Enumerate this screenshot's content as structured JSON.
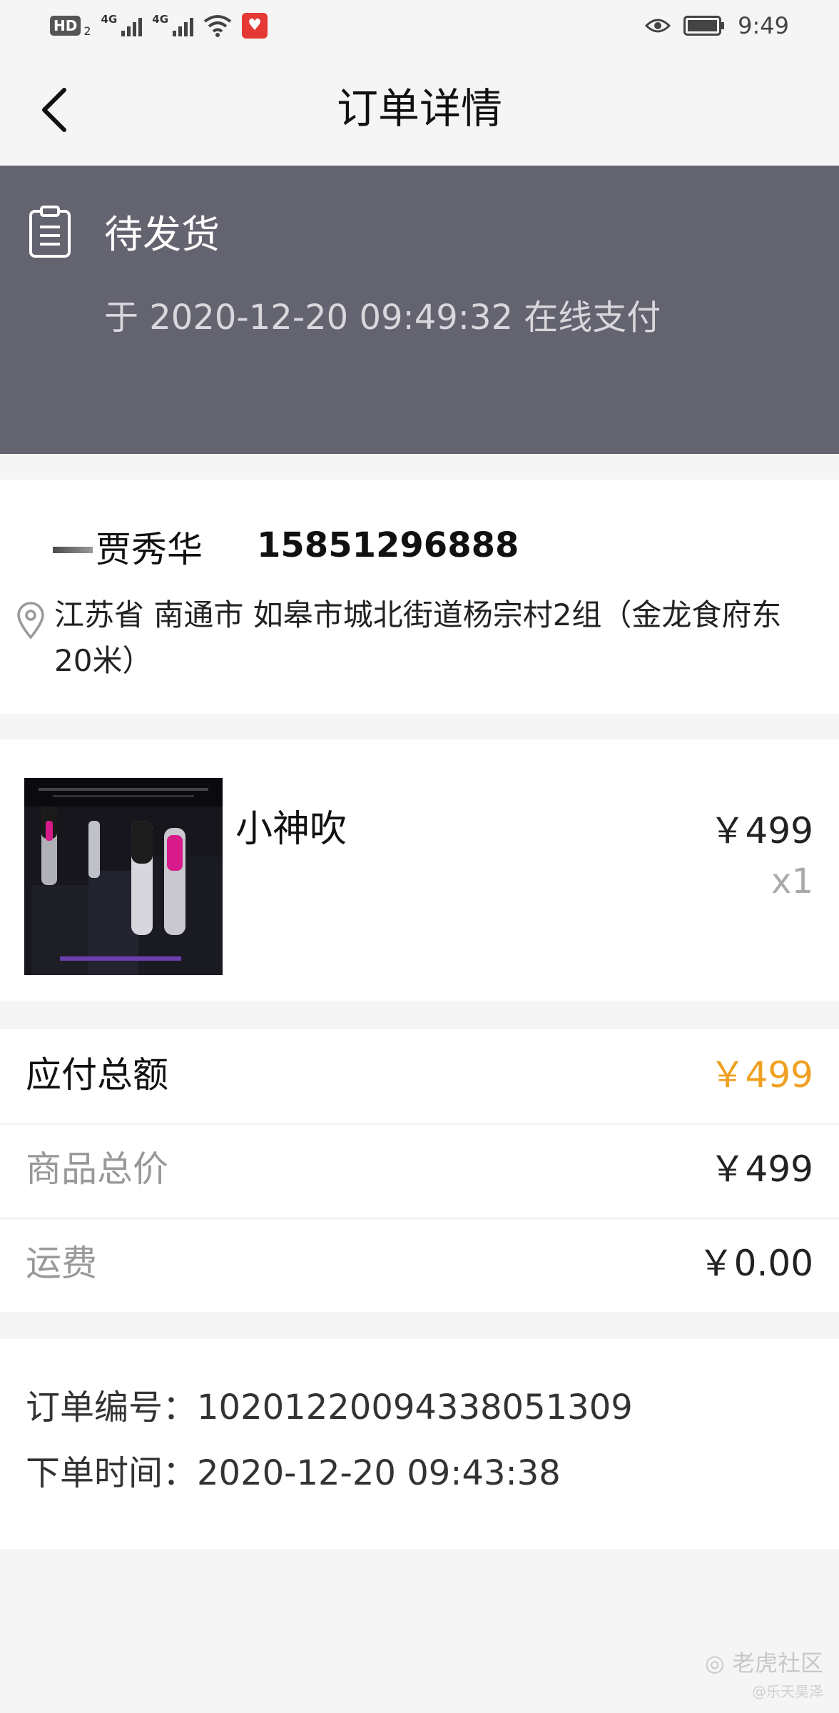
{
  "status_bar": {
    "hd": "HD",
    "hd_sub": "2",
    "network_1": "4G",
    "network_2": "4G",
    "time": "9:49"
  },
  "header": {
    "title": "订单详情"
  },
  "order_status": {
    "title": "待发货",
    "subtitle": "于 2020-12-20 09:49:32 在线支付"
  },
  "recipient": {
    "name": "贾秀华",
    "phone": "15851296888",
    "address": "江苏省 南通市 如皋市城北街道杨宗村2组（金龙食府东20米）"
  },
  "product": {
    "name": "小神吹",
    "price": "￥499",
    "quantity": "x1"
  },
  "summary": {
    "rows": [
      {
        "label": "应付总额",
        "value": "￥499"
      },
      {
        "label": "商品总价",
        "value": "￥499"
      },
      {
        "label": "运费",
        "value": "￥0.00"
      }
    ]
  },
  "order_info": {
    "number_line": "订单编号：10201220094338051309",
    "time_line": "下单时间：2020-12-20 09:43:38"
  },
  "watermark": {
    "text": "老虎社区",
    "sub": "@乐天昊泽"
  },
  "colors": {
    "banner_bg": "#636470",
    "total_price": "#f0a020",
    "page_bg": "#f5f5f5"
  }
}
